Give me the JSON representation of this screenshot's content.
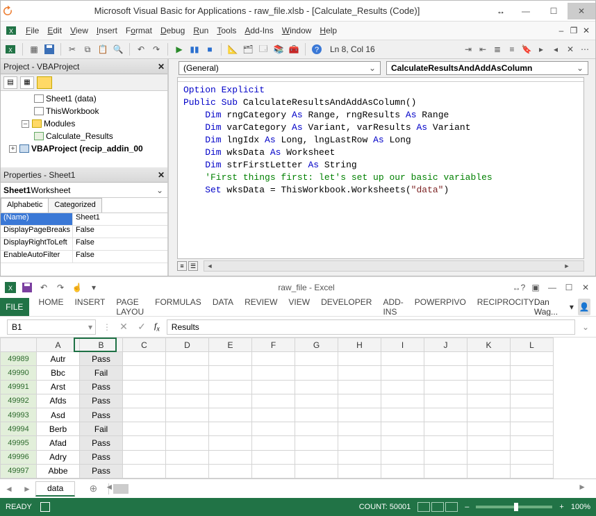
{
  "vba": {
    "title": "Microsoft Visual Basic for Applications - raw_file.xlsb - [Calculate_Results (Code)]",
    "menu": [
      "File",
      "Edit",
      "View",
      "Insert",
      "Format",
      "Debug",
      "Run",
      "Tools",
      "Add-Ins",
      "Window",
      "Help"
    ],
    "toolbarStatus": "Ln 8, Col 16",
    "project": {
      "title": "Project - VBAProject",
      "nodes": {
        "sheet1": "Sheet1 (data)",
        "thiswb": "ThisWorkbook",
        "modules": "Modules",
        "calcres": "Calculate_Results",
        "addin": "VBAProject (recip_addin_00"
      }
    },
    "properties": {
      "title": "Properties - Sheet1",
      "comboBold": "Sheet1",
      "comboType": " Worksheet",
      "tabs": [
        "Alphabetic",
        "Categorized"
      ],
      "rows": [
        {
          "k": "(Name)",
          "v": "Sheet1",
          "sel": true
        },
        {
          "k": "DisplayPageBreaks",
          "v": "False"
        },
        {
          "k": "DisplayRightToLeft",
          "v": "False"
        },
        {
          "k": "EnableAutoFilter",
          "v": "False"
        }
      ]
    },
    "combos": {
      "object": "(General)",
      "proc": "CalculateResultsAndAddAsColumn"
    },
    "code": [
      {
        "t": "Option Explicit",
        "cls": "kw"
      },
      {
        "segs": [
          {
            "t": "Public Sub ",
            "c": "kw"
          },
          {
            "t": "CalculateResultsAndAddAsColumn()"
          }
        ]
      },
      {
        "t": ""
      },
      {
        "segs": [
          {
            "t": "    Dim ",
            "c": "kw"
          },
          {
            "t": "rngCategory "
          },
          {
            "t": "As ",
            "c": "kw"
          },
          {
            "t": "Range, rngResults "
          },
          {
            "t": "As ",
            "c": "kw"
          },
          {
            "t": "Range"
          }
        ]
      },
      {
        "segs": [
          {
            "t": "    Dim ",
            "c": "kw"
          },
          {
            "t": "varCategory "
          },
          {
            "t": "As ",
            "c": "kw"
          },
          {
            "t": "Variant, varResults "
          },
          {
            "t": "As ",
            "c": "kw"
          },
          {
            "t": "Variant"
          }
        ]
      },
      {
        "segs": [
          {
            "t": "    Dim ",
            "c": "kw"
          },
          {
            "t": "lngIdx "
          },
          {
            "t": "As ",
            "c": "kw"
          },
          {
            "t": "Long, lngLastRow "
          },
          {
            "t": "As ",
            "c": "kw"
          },
          {
            "t": "Long"
          }
        ]
      },
      {
        "segs": [
          {
            "t": "    Dim ",
            "c": "kw"
          },
          {
            "t": "wksData "
          },
          {
            "t": "As ",
            "c": "kw"
          },
          {
            "t": "Worksheet"
          }
        ]
      },
      {
        "segs": [
          {
            "t": "    Dim ",
            "c": "kw"
          },
          {
            "t": "strFirstLetter "
          },
          {
            "t": "As ",
            "c": "kw"
          },
          {
            "t": "String"
          }
        ]
      },
      {
        "t": ""
      },
      {
        "t": "    'First things first: let's set up our basic variables",
        "cls": "cm"
      },
      {
        "segs": [
          {
            "t": "    Set ",
            "c": "kw"
          },
          {
            "t": "wksData = ThisWorkbook.Worksheets("
          },
          {
            "t": "\"data\"",
            "c": "str"
          },
          {
            "t": ")"
          }
        ]
      }
    ]
  },
  "excel": {
    "title": "raw_file - Excel",
    "ribbon": {
      "file": "FILE",
      "tabs": [
        "HOME",
        "INSERT",
        "PAGE LAYOU",
        "FORMULAS",
        "DATA",
        "REVIEW",
        "VIEW",
        "DEVELOPER",
        "ADD-INS",
        "POWERPIVO",
        "RECIPROCITY"
      ],
      "user": "Dan Wag..."
    },
    "nameBox": "B1",
    "formula": "Results",
    "cols": [
      "A",
      "B",
      "C",
      "D",
      "E",
      "F",
      "G",
      "H",
      "I",
      "J",
      "K",
      "L"
    ],
    "rows": [
      {
        "n": "49989",
        "a": "Autr",
        "b": "Pass"
      },
      {
        "n": "49990",
        "a": "Bbc",
        "b": "Fail"
      },
      {
        "n": "49991",
        "a": "Arst",
        "b": "Pass"
      },
      {
        "n": "49992",
        "a": "Afds",
        "b": "Pass"
      },
      {
        "n": "49993",
        "a": "Asd",
        "b": "Pass"
      },
      {
        "n": "49994",
        "a": "Berb",
        "b": "Fail"
      },
      {
        "n": "49995",
        "a": "Afad",
        "b": "Pass"
      },
      {
        "n": "49996",
        "a": "Adry",
        "b": "Pass"
      },
      {
        "n": "49997",
        "a": "Abbe",
        "b": "Pass"
      }
    ],
    "sheetTab": "data",
    "status": {
      "ready": "READY",
      "count": "COUNT: 50001",
      "zoom": "100%"
    }
  }
}
